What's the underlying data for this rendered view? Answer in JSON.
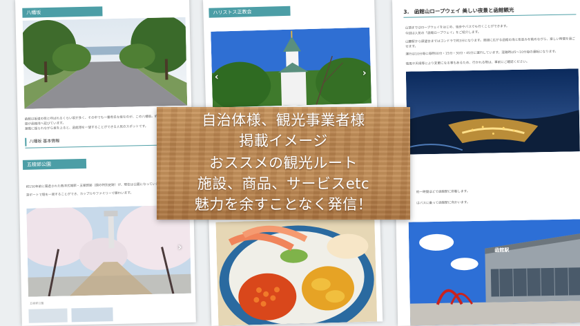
{
  "left_page": {
    "tag1": "八幡坂",
    "body1": "函館は坂道の街と呼ばれるくらい坂が多く、その中でも一番有名な坂なのが、この八幡坂。約270メートルの一本道が函館湾へ延びています。",
    "body1b": "潮風に揺られながら坂を上ると、函館港を一望することができる人気のスポットです。",
    "tag2": "八幡坂 基本情報",
    "tag3": "五稜郭公園",
    "body3": "約150年前に築造された西洋式城郭・五稜郭跡（国の特別史跡）が、現在は公園になっています。",
    "body3b": "貸ボートで堀を一周することができ、カップルやファミリーで賑わいます。",
    "caption": "五稜郭公園"
  },
  "middle_page": {
    "tag1": "ハリストス正教会"
  },
  "right_page": {
    "heading": "3.　函館山ロープウェイ 美しい夜景と函館観光",
    "body1": "山頂まではロープウェイをはじめ、徒歩やバスでも行くことができます。",
    "body2": "今回は人気の「函館ロープウェイ」をご紹介します。",
    "body3": "山麓駅から展望台まではゴンドラで約3分になります。周囲に広がる函館の海と街並みを眺めながら、楽しい時間を過ごせます。",
    "body4": "運行は10分毎に毎時00分・15分・30分・45分に運行しています。混雑時は5〜10分毎の運転になります。",
    "body5": "強風や天候等により変更になる事もあるため、行かれる際は、事前にご確認ください。",
    "body6": "約一時間ほどで函館駅に到着します。",
    "body7": "はバスに乗って函館駅に向かいます。",
    "station_sign": "函館駅"
  },
  "overlay": {
    "line1": "自治体様、観光事業者様",
    "line2": "掲載イメージ",
    "line3": "おススメの観光ルート",
    "line4": "施設、商品、サービスetc",
    "line5": "魅力を余すことなく発信！"
  },
  "icons": {
    "left_arrow": "‹",
    "right_arrow": "›"
  }
}
